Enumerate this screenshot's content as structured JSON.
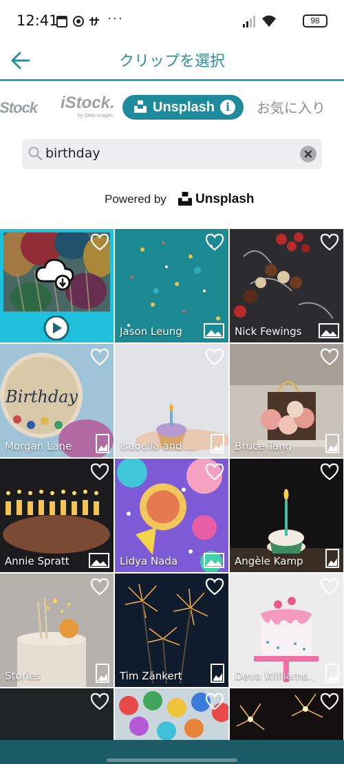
{
  "status_bar": {
    "time": "12:41",
    "battery": "98",
    "more": "···"
  },
  "header": {
    "title": "クリップを選択"
  },
  "tabs": {
    "items": [
      {
        "label": "iStock",
        "state": "partial"
      },
      {
        "label": "iStock.",
        "sub": "by Getty Images"
      },
      {
        "label": "Unsplash",
        "selected": true
      },
      {
        "label": "お気に入り"
      }
    ],
    "partial_label": "iStock"
  },
  "search": {
    "value": "birthday"
  },
  "powered": {
    "prefix": "Powered by",
    "brand": "Unsplash"
  },
  "colors": {
    "accent": "#2aa6b8",
    "tab_selected": "#1f8a9b",
    "selected_frame": "#1fc0dc"
  },
  "grid": {
    "items": [
      {
        "author": "",
        "type": "video",
        "selected": true
      },
      {
        "author": "Jason Leung",
        "type": "image-landscape"
      },
      {
        "author": "Nick Fewings",
        "type": "image-landscape"
      },
      {
        "author": "Morgan Lane",
        "type": "image-portrait"
      },
      {
        "author": "Isabella and ...",
        "type": "image-portrait"
      },
      {
        "author": "Bruce Tang",
        "type": "image-portrait"
      },
      {
        "author": "Annie Spratt",
        "type": "image-landscape"
      },
      {
        "author": "Lidya Nada",
        "type": "image-landscape"
      },
      {
        "author": "Angèle Kamp",
        "type": "image-portrait"
      },
      {
        "author": "Stories",
        "type": "image-portrait"
      },
      {
        "author": "Tim Zänkert",
        "type": "image-portrait"
      },
      {
        "author": "Deva Williams...",
        "type": "image-portrait"
      },
      {
        "author": "",
        "type": ""
      },
      {
        "author": "",
        "type": ""
      },
      {
        "author": "",
        "type": ""
      }
    ]
  }
}
